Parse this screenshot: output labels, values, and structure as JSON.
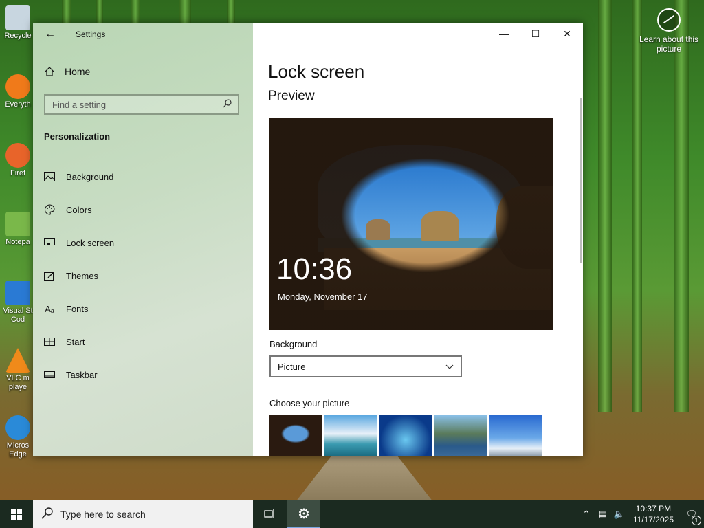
{
  "desktop": {
    "icons": [
      {
        "label": "Recycle",
        "color": "#c8d6e0"
      },
      {
        "label": "Everyth",
        "color": "#f07a1a"
      },
      {
        "label": "Firef",
        "color": "#e8642a"
      },
      {
        "label": "Notepa",
        "color": "#7ab84a"
      },
      {
        "label": "Visual St Cod",
        "color": "#2a7ad4"
      },
      {
        "label": "VLC m playe",
        "color": "#f08a1a"
      },
      {
        "label": "Micros Edge",
        "color": "#2a8ad8"
      }
    ],
    "learn_label": "Learn about this picture"
  },
  "window": {
    "title": "Settings",
    "nav": {
      "home": "Home",
      "search_placeholder": "Find a setting",
      "section": "Personalization",
      "items": [
        {
          "label": "Background",
          "icon": "image-icon"
        },
        {
          "label": "Colors",
          "icon": "palette-icon"
        },
        {
          "label": "Lock screen",
          "icon": "lock-screen-icon"
        },
        {
          "label": "Themes",
          "icon": "brush-icon"
        },
        {
          "label": "Fonts",
          "icon": "font-icon"
        },
        {
          "label": "Start",
          "icon": "start-icon"
        },
        {
          "label": "Taskbar",
          "icon": "taskbar-icon"
        }
      ]
    },
    "content": {
      "title": "Lock screen",
      "preview_heading": "Preview",
      "preview_time": "10:36",
      "preview_date": "Monday, November 17",
      "background_label": "Background",
      "background_value": "Picture",
      "choose_label": "Choose your picture"
    }
  },
  "taskbar": {
    "search_placeholder": "Type here to search",
    "time": "10:37 PM",
    "date": "11/17/2025",
    "notification_count": "1"
  },
  "colors": {
    "accent": "#7aa6e0",
    "taskbar": "#1b2a20",
    "nav_bg": "#c7dcc2"
  }
}
